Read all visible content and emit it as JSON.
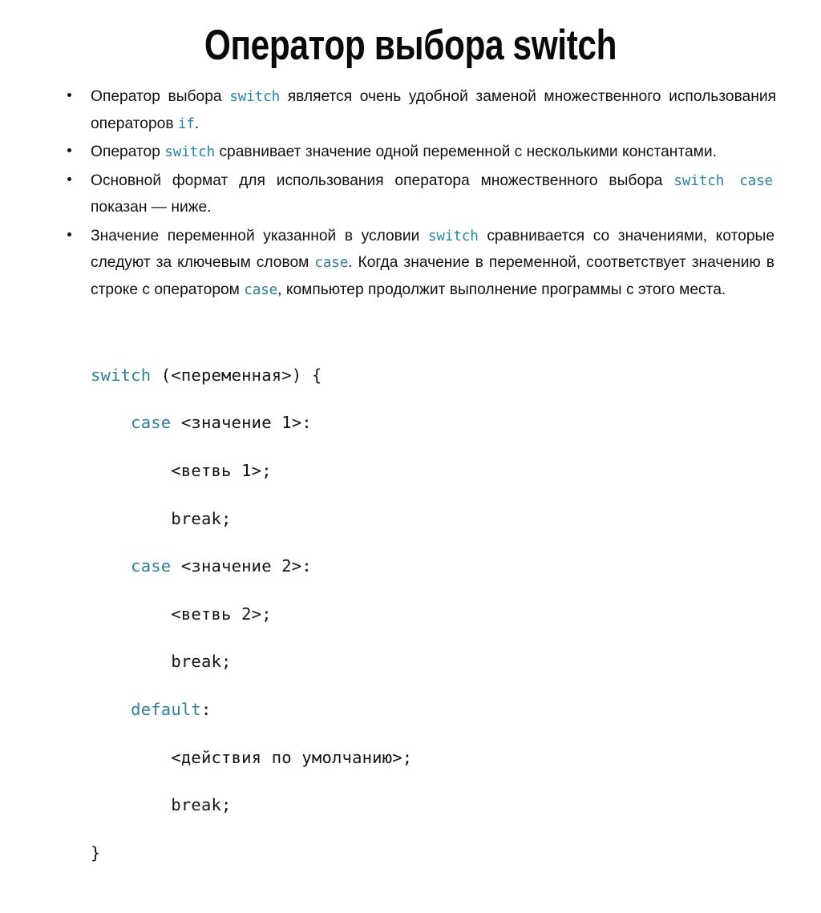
{
  "slide": {
    "title": "Оператор выбора switch",
    "background_color": "#ffffff",
    "text_color": "#121212",
    "keyword_color": "#2a85a6",
    "code_keyword_color": "#2e7f9e"
  },
  "bullets": [
    {
      "id": "bullet-1",
      "parts": [
        {
          "type": "text",
          "value": "Оператор выбора "
        },
        {
          "type": "code",
          "value": "switch"
        },
        {
          "type": "text",
          "value": " является очень удобной заменой множественного использования операторов "
        },
        {
          "type": "code",
          "value": "if"
        },
        {
          "type": "text",
          "value": "."
        }
      ],
      "p1": "Оператор выбора ",
      "kw1": "switch",
      "p2": " является очень удобной заменой множественного использования операторов ",
      "kw2": "if",
      "p3": "."
    },
    {
      "id": "bullet-2",
      "p1": " Оператор ",
      "kw1": "switch",
      "p2": " сравнивает значение одной переменной с несколькими константами."
    },
    {
      "id": "bullet-3",
      "p1": "Основной формат для использования оператора множественного выбора ",
      "kw1": "switch case",
      "p2": " показан — ниже."
    },
    {
      "id": "bullet-4",
      "p1": " Значение переменной указанной в условии ",
      "kw1": "switch",
      "p2": " сравнивается со значениями, которые следуют за ключевым словом ",
      "kw2": "case",
      "p3": ". Когда значение в переменной, соответствует значению в строке с оператором ",
      "kw3": "case",
      "p4": ", компьютер продолжит выполнение программы с этого места."
    }
  ],
  "code_block": {
    "language": "c",
    "lines": [
      {
        "keyword": "switch",
        "rest": " (<переменная>) {",
        "indent": 0
      },
      {
        "keyword": "case",
        "rest": " <значение 1>:",
        "indent": 4
      },
      {
        "keyword": "",
        "rest": "<ветвь 1>;",
        "indent": 8
      },
      {
        "keyword": "",
        "rest": "break;",
        "indent": 8
      },
      {
        "keyword": "case",
        "rest": " <значение 2>:",
        "indent": 4
      },
      {
        "keyword": "",
        "rest": "<ветвь 2>;",
        "indent": 8
      },
      {
        "keyword": "",
        "rest": "break;",
        "indent": 8
      },
      {
        "keyword": "default",
        "rest": ":",
        "indent": 4
      },
      {
        "keyword": "",
        "rest": "<действия по умолчанию>;",
        "indent": 8
      },
      {
        "keyword": "",
        "rest": "break;",
        "indent": 8
      },
      {
        "keyword": "",
        "rest": "}",
        "indent": 0
      }
    ],
    "rendered": {
      "l1_kw": "switch",
      "l1_rest": " (<переменная>) {",
      "l2_indent": "    ",
      "l2_kw": "case",
      "l2_rest": " <значение 1>:",
      "l3": "        <ветвь 1>;",
      "l4": "        break;",
      "l5_indent": "    ",
      "l5_kw": "case",
      "l5_rest": " <значение 2>:",
      "l6": "        <ветвь 2>;",
      "l7": "        break;",
      "l8_indent": "    ",
      "l8_kw": "default",
      "l8_rest": ":",
      "l9": "        <действия по умолчанию>;",
      "l10": "        break;",
      "l11": "}"
    }
  }
}
